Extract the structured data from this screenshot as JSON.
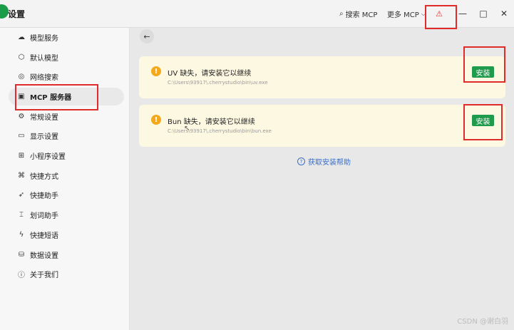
{
  "titlebar": {
    "title": "设置",
    "search_mcp": "搜索 MCP",
    "more_mcp": "更多 MCP",
    "warning_icon": "⚠",
    "minimize": "—",
    "maximize": "□",
    "close": "✕"
  },
  "sidebar": {
    "items": [
      {
        "label": "模型服务",
        "icon": "cloud-icon",
        "glyph": "☁"
      },
      {
        "label": "默认模型",
        "icon": "cube-icon",
        "glyph": "⬡"
      },
      {
        "label": "网络搜索",
        "icon": "globe-icon",
        "glyph": "◎"
      },
      {
        "label": "MCP 服务器",
        "icon": "terminal-icon",
        "glyph": "▣",
        "active": true
      },
      {
        "label": "常规设置",
        "icon": "settings-icon",
        "glyph": "⚙"
      },
      {
        "label": "显示设置",
        "icon": "monitor-icon",
        "glyph": "▭"
      },
      {
        "label": "小程序设置",
        "icon": "grid-icon",
        "glyph": "⊞"
      },
      {
        "label": "快捷方式",
        "icon": "command-icon",
        "glyph": "⌘"
      },
      {
        "label": "快捷助手",
        "icon": "rocket-icon",
        "glyph": "➶"
      },
      {
        "label": "划词助手",
        "icon": "text-select-icon",
        "glyph": "⌶"
      },
      {
        "label": "快捷短语",
        "icon": "zap-icon",
        "glyph": "ϟ"
      },
      {
        "label": "数据设置",
        "icon": "database-icon",
        "glyph": "⛁"
      },
      {
        "label": "关于我们",
        "icon": "info-icon",
        "glyph": "ⓘ"
      }
    ]
  },
  "main": {
    "back_icon": "←",
    "cards": [
      {
        "title": "UV 缺失，请安装它以继续",
        "path": "C:\\Users\\93917\\.cherrystudio\\bin\\uv.exe",
        "button": "安装"
      },
      {
        "title": "Bun 缺失，请安装它以继续",
        "path": "C:\\Users\\93917\\.cherrystudio\\bin\\bun.exe",
        "button": "安装"
      }
    ],
    "help_link": "获取安装帮助"
  },
  "watermark": "CSDN @谢白羽",
  "colors": {
    "accent_green": "#1f9c4b",
    "warning_orange": "#f4a91c",
    "annotation_red": "#e02b2b",
    "card_bg": "#fdf8e1",
    "link_blue": "#3b6ec5"
  }
}
